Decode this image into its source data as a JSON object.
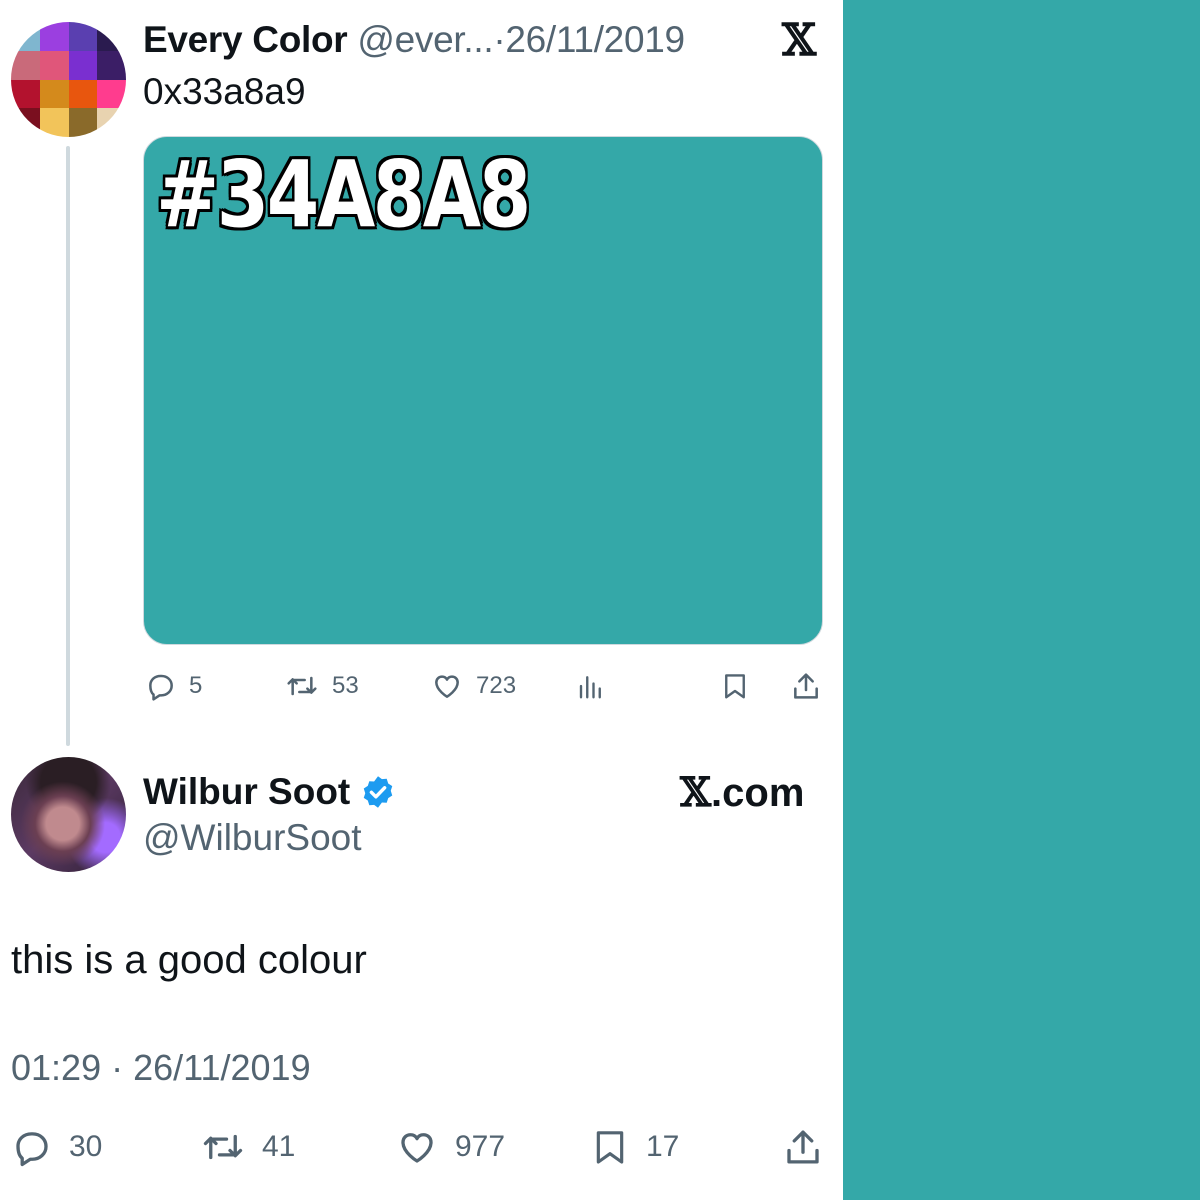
{
  "theme": {
    "swatch_color": "#34a8a8",
    "line_color": "#cfd9de",
    "muted_text": "#536471",
    "verified_color": "#1d9bf0"
  },
  "tweet1": {
    "display_name": "Every Color",
    "handle": "@ever...",
    "separator": "·",
    "date": "26/11/2019",
    "body": "0x33a8a9",
    "media_label": "#34A8A8",
    "avatar_colors": [
      "#7fb6cf",
      "#9b3fe0",
      "#5a3fb0",
      "#2a1b4f",
      "#c96a7a",
      "#e0567a",
      "#7a2fd0",
      "#3b1e66",
      "#b3122e",
      "#d48a1c",
      "#e8560e",
      "#ff3c8e",
      "#7a0f1f",
      "#f2c45a",
      "#8a6a2a",
      "#e8d3b0"
    ],
    "actions": {
      "reply": {
        "icon": "reply-icon",
        "count": "5"
      },
      "retweet": {
        "icon": "retweet-icon",
        "count": "53"
      },
      "like": {
        "icon": "heart-icon",
        "count": "723"
      },
      "views": {
        "icon": "views-icon"
      },
      "bookmark": {
        "icon": "bookmark-icon"
      },
      "share": {
        "icon": "share-icon"
      }
    }
  },
  "logo": {
    "x_symbol": "𝕏"
  },
  "tweet2": {
    "display_name": "Wilbur Soot",
    "handle": "@WilburSoot",
    "site_x": "𝕏",
    "site_suffix": ".com",
    "body": "this is a good colour",
    "timestamp": "01:29 · 26/11/2019",
    "actions": {
      "reply": {
        "icon": "reply-icon",
        "count": "30"
      },
      "retweet": {
        "icon": "retweet-icon",
        "count": "41"
      },
      "like": {
        "icon": "heart-icon",
        "count": "977"
      },
      "bookmark": {
        "icon": "bookmark-icon",
        "count": "17"
      },
      "share": {
        "icon": "share-icon"
      }
    }
  }
}
